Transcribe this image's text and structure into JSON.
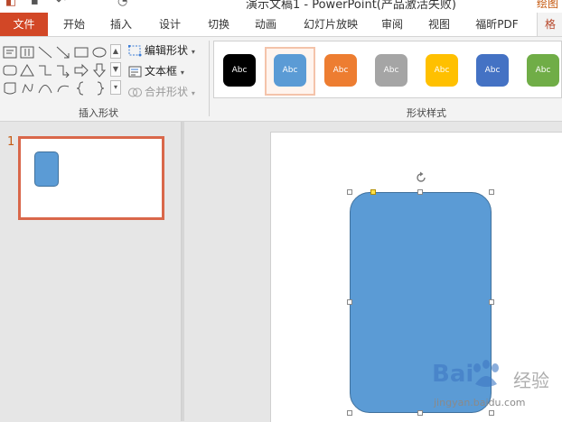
{
  "window": {
    "title": "演示文稿1 - PowerPoint(产品激活失败)",
    "user_name": "绘图"
  },
  "ribbon_tabs": [
    {
      "label": "文件",
      "kind": "file"
    },
    {
      "label": "开始"
    },
    {
      "label": "插入"
    },
    {
      "label": "设计"
    },
    {
      "label": "切换"
    },
    {
      "label": "动画"
    },
    {
      "label": "幻灯片放映"
    },
    {
      "label": "审阅"
    },
    {
      "label": "视图"
    },
    {
      "label": "福昕PDF"
    },
    {
      "label": "格",
      "active": true
    }
  ],
  "insert_shapes": {
    "group_label": "插入形状",
    "edit_shape_label": "编辑形状",
    "text_box_label": "文本框",
    "merge_shapes_label": "合并形状"
  },
  "shape_styles": {
    "group_label": "形状样式",
    "swatch_label": "Abc",
    "swatches": [
      {
        "color": "#000000"
      },
      {
        "color": "#5b9bd5",
        "selected": true
      },
      {
        "color": "#ed7d31"
      },
      {
        "color": "#a5a5a5"
      },
      {
        "color": "#ffc000"
      },
      {
        "color": "#4472c4"
      },
      {
        "color": "#70ad47"
      }
    ]
  },
  "thumbnails": {
    "slide_number": "1"
  },
  "shape": {
    "fill_color": "#5b9bd5",
    "outline_color": "#41719c",
    "type": "rounded-rectangle"
  },
  "watermark": {
    "brand": "Bai",
    "brand_suffix": "经验",
    "url": "jingyan.baidu.com"
  }
}
